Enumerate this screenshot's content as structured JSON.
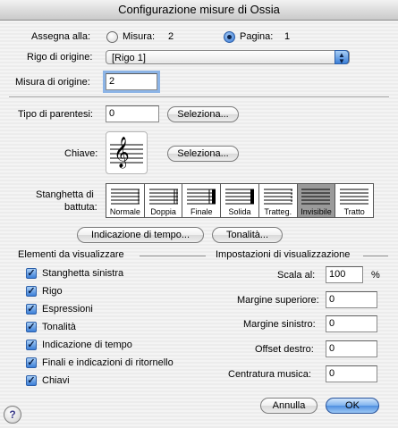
{
  "window": {
    "title": "Configurazione misure di Ossia"
  },
  "assign": {
    "label": "Assegna alla:",
    "measure_label": "Misura:",
    "measure_value": "2",
    "page_label": "Pagina:",
    "page_value": "1",
    "selected": "page"
  },
  "origin_staff": {
    "label": "Rigo di origine:",
    "value": "[Rigo 1]"
  },
  "origin_measure": {
    "label": "Misura di origine:",
    "value": "2"
  },
  "bracket": {
    "label": "Tipo di parentesi:",
    "value": "0",
    "select_label": "Seleziona..."
  },
  "clef": {
    "label": "Chiave:",
    "select_label": "Seleziona...",
    "glyph": "𝄞"
  },
  "barline": {
    "label_line1": "Stanghetta di",
    "label_line2": "battuta:",
    "options": [
      "Normale",
      "Doppia",
      "Finale",
      "Solida",
      "Tratteg.",
      "Invisibile",
      "Tratto"
    ],
    "selected": "Invisibile"
  },
  "buttons": {
    "tempo": "Indicazione di tempo...",
    "key": "Tonalità...",
    "cancel": "Annulla",
    "ok": "OK",
    "help": "?"
  },
  "elements": {
    "title": "Elementi da visualizzare",
    "items": [
      {
        "label": "Stanghetta sinistra",
        "checked": true
      },
      {
        "label": "Rigo",
        "checked": true
      },
      {
        "label": "Espressioni",
        "checked": true
      },
      {
        "label": "Tonalità",
        "checked": true
      },
      {
        "label": "Indicazione di tempo",
        "checked": true
      },
      {
        "label": "Finali e indicazioni di ritornello",
        "checked": true
      },
      {
        "label": "Chiavi",
        "checked": true
      }
    ]
  },
  "display": {
    "title": "Impostazioni di visualizzazione",
    "scale_label": "Scala al:",
    "scale_value": "100",
    "scale_unit": "%",
    "top_margin_label": "Margine superiore:",
    "top_margin_value": "0",
    "left_margin_label": "Margine sinistro:",
    "left_margin_value": "0",
    "right_offset_label": "Offset destro:",
    "right_offset_value": "0",
    "centering_label": "Centratura musica:",
    "centering_value": "0"
  },
  "colors": {
    "accent": "#3b7fd8",
    "selected_barline": "#9a9a9a"
  }
}
